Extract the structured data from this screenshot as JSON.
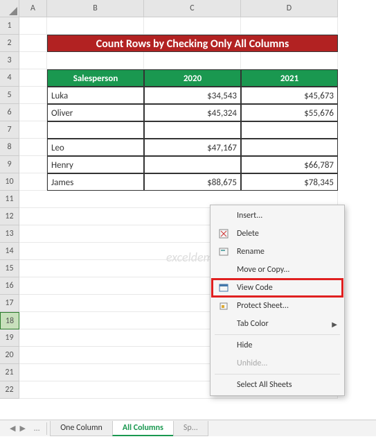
{
  "columns": [
    "A",
    "B",
    "C",
    "D"
  ],
  "title": "Count Rows by Checking Only All Columns",
  "headers": {
    "salesperson": "Salesperson",
    "y2020": "2020",
    "y2021": "2021"
  },
  "rows": [
    {
      "name": "Luka",
      "v2020": "$34,543",
      "v2021": "$45,673"
    },
    {
      "name": "Oliver",
      "v2020": "$45,324",
      "v2021": "$55,676"
    },
    {
      "name": "",
      "v2020": "",
      "v2021": ""
    },
    {
      "name": "Leo",
      "v2020": "$47,167",
      "v2021": ""
    },
    {
      "name": "Henry",
      "v2020": "",
      "v2021": "$66,787"
    },
    {
      "name": "James",
      "v2020": "$88,675",
      "v2021": "$78,345"
    }
  ],
  "watermark": "exceldemy",
  "menu": {
    "insert": "Insert...",
    "delete": "Delete",
    "rename": "Rename",
    "move": "Move or Copy...",
    "view_code": "View Code",
    "protect": "Protect Sheet...",
    "tab_color": "Tab Color",
    "hide": "Hide",
    "unhide": "Unhide...",
    "select_all": "Select All Sheets"
  },
  "tabs": {
    "prev": "One Column",
    "active": "All Columns",
    "next": "Sp..."
  },
  "selected_row": 18
}
